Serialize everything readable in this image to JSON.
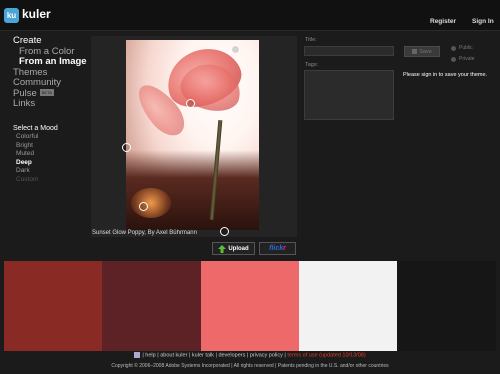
{
  "header": {
    "logo_badge": "ku",
    "logo_text": "kuler",
    "register": "Register",
    "signin": "Sign In"
  },
  "sidebar": {
    "items": [
      {
        "label": "Create"
      },
      {
        "label": "From a Color"
      },
      {
        "label": "From an Image"
      },
      {
        "label": "Themes"
      },
      {
        "label": "Community"
      },
      {
        "label": "Pulse"
      },
      {
        "label": "Links"
      }
    ],
    "beta_badge": "BETA"
  },
  "mood": {
    "title": "Select a Mood",
    "items": [
      "Colorful",
      "Bright",
      "Muted",
      "Deep",
      "Dark",
      "Custom"
    ],
    "selected": "Deep"
  },
  "image": {
    "caption": "Sunset Glow Poppy, By Axel Bührmann"
  },
  "buttons": {
    "upload": "Upload",
    "flickr_a": "flick",
    "flickr_b": "r"
  },
  "form": {
    "title_label": "Title:",
    "tags_label": "Tags:",
    "save_label": "Save",
    "public_label": "Public",
    "private_label": "Private",
    "signin_message": "Please sign in to save your theme."
  },
  "palette": {
    "colors": [
      "#8a2a25",
      "#5c2225",
      "#ee6a6a",
      "#f2f2f2",
      "#161616"
    ]
  },
  "footer": {
    "help": "help",
    "about": "about kuler",
    "talk": "kuler talk",
    "developers": "developers",
    "privacy": "privacy policy",
    "terms": "terms of use (updated 10/13/08)",
    "copyright": "Copyright © 2006–2008 Adobe Systems Incorporated | All rights reserved | Patents pending in the U.S. and/or other countries"
  }
}
